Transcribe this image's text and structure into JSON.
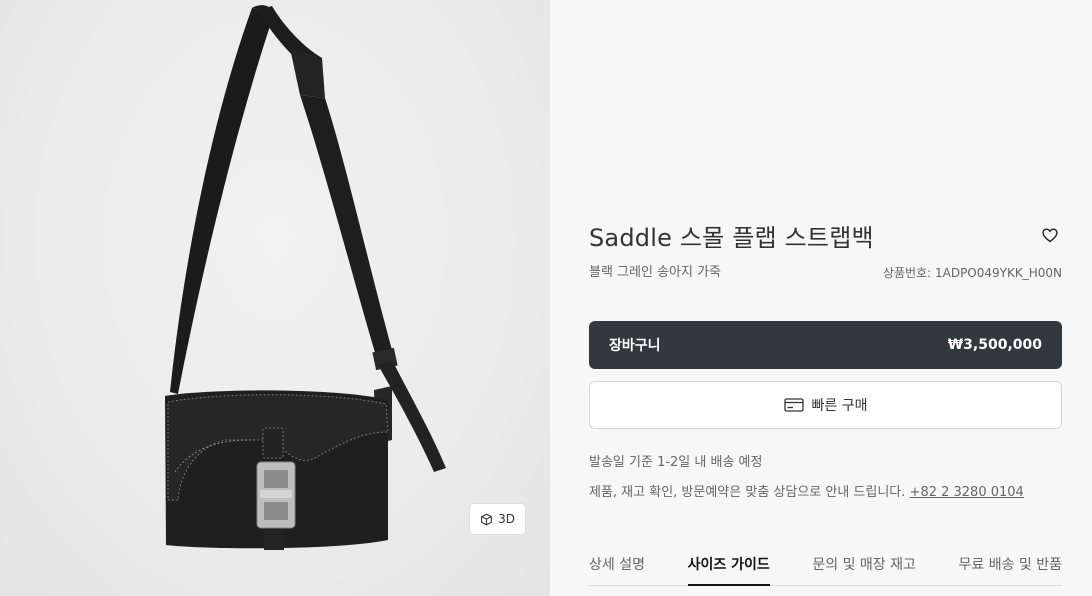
{
  "gallery": {
    "view_3d_label": "3D",
    "icon": "cube-icon"
  },
  "product": {
    "title": "Saddle 스몰 플랩 스트랩백",
    "subtitle": "블랙 그레인 송아지 가죽",
    "sku": "상품번호: 1ADPO049YKK_H00N",
    "wishlist_icon": "heart-icon"
  },
  "actions": {
    "cart_label": "장바구니",
    "price": "₩3,500,000",
    "quick_buy_label": "빠른 구매",
    "quick_buy_icon": "credit-card-icon"
  },
  "info": {
    "shipping": "발송일 기준 1-2일 내 배송 예정",
    "contact_text": "제품, 재고 확인, 방문예약은 맞춤 상담으로 안내 드립니다.",
    "phone": "+82 2 3280 0104"
  },
  "tabs": [
    {
      "label": "상세 설명",
      "active": false
    },
    {
      "label": "사이즈 가이드",
      "active": true
    },
    {
      "label": "문의 및 매장 재고",
      "active": false
    },
    {
      "label": "무료 배송 및 반품",
      "active": false
    }
  ],
  "colors": {
    "cart_bg": "#33383c",
    "page_bg": "#f7f7f7",
    "text": "#333333"
  }
}
